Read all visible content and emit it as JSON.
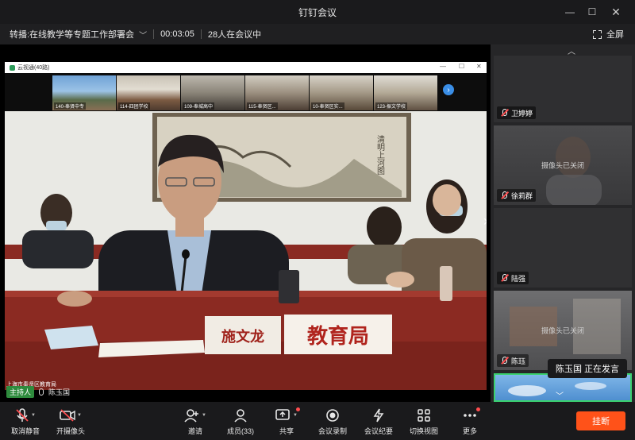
{
  "window": {
    "title": "钉钉会议",
    "minimize": "—",
    "maximize": "☐",
    "close": "✕"
  },
  "meeting": {
    "title": "转播:在线教学等专题工作部署会",
    "duration": "00:03:05",
    "attendees": "28人在会议中",
    "fullscreen_label": "全屏"
  },
  "inner_window": {
    "title": "云视通(40路)",
    "minimize": "—",
    "maximize": "☐",
    "close": "✕"
  },
  "thumbnails": [
    {
      "caption": "140-奉贤中专"
    },
    {
      "caption": "114-四团学校"
    },
    {
      "caption": "109-奉城高中"
    },
    {
      "caption": "115-奉贤区..."
    },
    {
      "caption": "10-奉贤区实..."
    },
    {
      "caption": "123-振文学校"
    }
  ],
  "scene": {
    "nameplate_name": "施文龙",
    "nameplate_org": "教育局",
    "watermark": "上海市奉贤区教育局",
    "calligraphy": "清明上河图"
  },
  "host": {
    "tag": "主持人",
    "name": "陈玉国"
  },
  "participants": [
    {
      "name": "卫婷婷",
      "status": ""
    },
    {
      "name": "徐莉群",
      "status": "摄像头已关闭"
    },
    {
      "name": "陆强",
      "status": ""
    },
    {
      "name": "陈珏",
      "status": "摄像头已关闭"
    }
  ],
  "speaking": "陈玉国  正在发言",
  "toolbar": {
    "unmute": "取消静音",
    "camera": "开摄像头",
    "invite": "邀请",
    "members": "成员(33)",
    "share": "共享",
    "record": "会议录制",
    "minutes": "会议纪要",
    "switch_view": "切换视图",
    "more": "更多",
    "hangup": "挂断"
  },
  "colors": {
    "hangup": "#ff5219",
    "host_tag": "#2e8b3d",
    "accent": "#3a8ee6"
  }
}
